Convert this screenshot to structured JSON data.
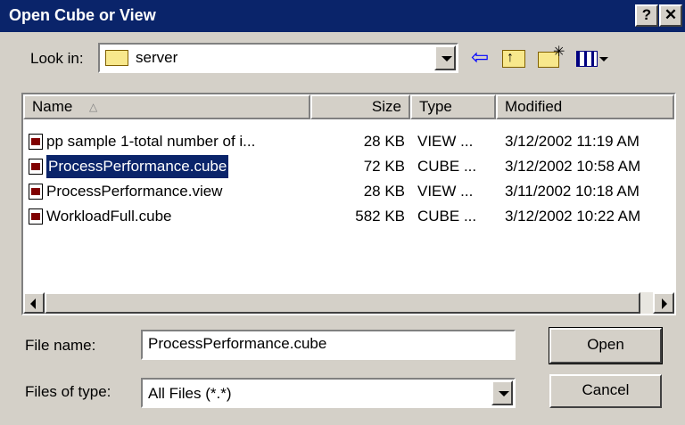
{
  "window": {
    "title": "Open Cube or View",
    "help_label": "?",
    "close_label": "✕"
  },
  "lookin": {
    "label": "Look in:",
    "value": "server"
  },
  "toolbar": {
    "back_icon": "back-arrow-icon",
    "up_icon": "up-folder-icon",
    "newfolder_icon": "new-folder-icon",
    "view_icon": "view-menu-icon"
  },
  "columns": {
    "name": "Name",
    "size": "Size",
    "type": "Type",
    "modified": "Modified"
  },
  "files": [
    {
      "name": "pp sample 1-total number of i...",
      "size": "28 KB",
      "type": "VIEW ...",
      "modified": "3/12/2002 11:19 AM"
    },
    {
      "name": "ProcessPerformance.cube",
      "size": "72 KB",
      "type": "CUBE ...",
      "modified": "3/12/2002 10:58 AM"
    },
    {
      "name": "ProcessPerformance.view",
      "size": "28 KB",
      "type": "VIEW ...",
      "modified": "3/11/2002 10:18 AM"
    },
    {
      "name": "WorkloadFull.cube",
      "size": "582 KB",
      "type": "CUBE ...",
      "modified": "3/12/2002 10:22 AM"
    }
  ],
  "filename": {
    "label": "File name:",
    "value": "ProcessPerformance.cube"
  },
  "filetype": {
    "label": "Files of type:",
    "value": "All Files (*.*)"
  },
  "buttons": {
    "open": "Open",
    "cancel": "Cancel"
  }
}
